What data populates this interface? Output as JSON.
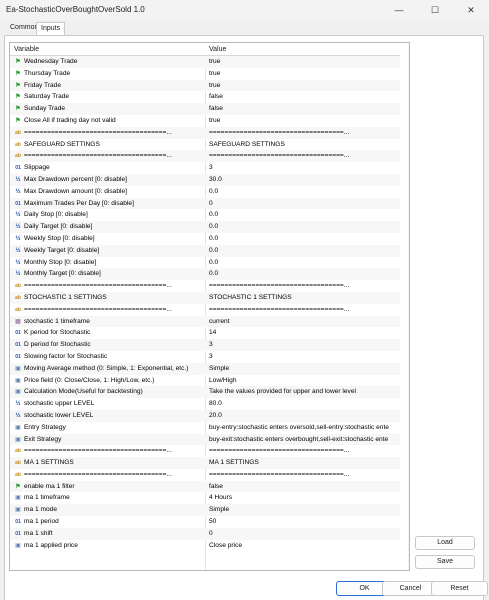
{
  "window": {
    "title": "Ea-StochasticOverBoughtOverSold 1.0",
    "minimize_glyph": "—",
    "maximize_glyph": "☐",
    "close_glyph": "✕"
  },
  "tabs": [
    {
      "label": "Common"
    },
    {
      "label": "Inputs"
    }
  ],
  "grid": {
    "headers": {
      "variable": "Variable",
      "value": "Value"
    },
    "rows": [
      {
        "type": "bool",
        "icon": "green-flag-icon",
        "label": "Wednesday Trade",
        "value": "true"
      },
      {
        "type": "bool",
        "icon": "green-flag-icon",
        "label": "Thursday Trade",
        "value": "true"
      },
      {
        "type": "bool",
        "icon": "green-flag-icon",
        "label": "Friday Trade",
        "value": "true"
      },
      {
        "type": "bool",
        "icon": "green-flag-icon",
        "label": "Saturday Trade",
        "value": "false"
      },
      {
        "type": "bool",
        "icon": "green-flag-icon",
        "label": "Sunday Trade",
        "value": "false"
      },
      {
        "type": "bool",
        "icon": "green-flag-icon",
        "label": "Close All if trading day not valid",
        "value": "true"
      },
      {
        "type": "ab",
        "icon": "string-icon",
        "label": "=====================================...",
        "value": "===================================..."
      },
      {
        "type": "ab",
        "icon": "string-icon",
        "label": "SAFEGUARD SETTINGS",
        "value": "SAFEGUARD SETTINGS"
      },
      {
        "type": "ab",
        "icon": "string-icon",
        "label": "=====================================...",
        "value": "===================================..."
      },
      {
        "type": "int",
        "icon": "integer-icon",
        "label": "Slippage",
        "value": "3"
      },
      {
        "type": "dbl",
        "icon": "double-icon",
        "label": "Max Drawdown percent [0: disable]",
        "value": "30.0"
      },
      {
        "type": "dbl",
        "icon": "double-icon",
        "label": "Max Drawdown amount [0: disable]",
        "value": "0.0"
      },
      {
        "type": "int",
        "icon": "integer-icon",
        "label": "Maximum Trades Per Day [0: disable]",
        "value": "0"
      },
      {
        "type": "dbl",
        "icon": "double-icon",
        "label": "Daily Stop [0: disable]",
        "value": "0.0"
      },
      {
        "type": "dbl",
        "icon": "double-icon",
        "label": "Daily Target [0: disable]",
        "value": "0.0"
      },
      {
        "type": "dbl",
        "icon": "double-icon",
        "label": "Weekly Stop [0: disable]",
        "value": "0.0"
      },
      {
        "type": "dbl",
        "icon": "double-icon",
        "label": "Weekly Target [0: disable]",
        "value": "0.0"
      },
      {
        "type": "dbl",
        "icon": "double-icon",
        "label": "Monthly Stop [0: disable]",
        "value": "0.0"
      },
      {
        "type": "dbl",
        "icon": "double-icon",
        "label": "Monthly Target [0: disable]",
        "value": "0.0"
      },
      {
        "type": "ab",
        "icon": "string-icon",
        "label": "=====================================...",
        "value": "===================================..."
      },
      {
        "type": "ab",
        "icon": "string-icon",
        "label": "STOCHASTIC 1 SETTINGS",
        "value": "STOCHASTIC 1 SETTINGS"
      },
      {
        "type": "ab",
        "icon": "string-icon",
        "label": "=====================================...",
        "value": "===================================..."
      },
      {
        "type": "list",
        "icon": "timeframe-icon",
        "label": "stochastic 1 timeframe",
        "value": "current"
      },
      {
        "type": "int",
        "icon": "integer-icon",
        "label": "K period for Stochastic",
        "value": "14"
      },
      {
        "type": "int",
        "icon": "integer-icon",
        "label": "D period for Stochastic",
        "value": "3"
      },
      {
        "type": "int",
        "icon": "integer-icon",
        "label": "Slowing factor for Stochastic",
        "value": "3"
      },
      {
        "type": "enum",
        "icon": "enum-icon",
        "label": "Moving Average method (0: Simple, 1: Exponential, etc.)",
        "value": "Simple"
      },
      {
        "type": "enum",
        "icon": "enum-icon",
        "label": "Price field (0: Close/Close, 1: High/Low, etc.)",
        "value": "Low/High"
      },
      {
        "type": "enum",
        "icon": "enum-icon",
        "label": "Calculation Mode(Useful for backtesting)",
        "value": "Take the values provided for upper and lower level"
      },
      {
        "type": "dbl",
        "icon": "double-icon",
        "label": "stochastic upper LEVEL",
        "value": "80.0"
      },
      {
        "type": "dbl",
        "icon": "double-icon",
        "label": "stochastic lower LEVEL",
        "value": "20.0"
      },
      {
        "type": "enum",
        "icon": "enum-icon",
        "label": "Entry Strategy",
        "value": "buy-entry:stochastic enters oversold,sell-entry:stochastic ente"
      },
      {
        "type": "enum",
        "icon": "enum-icon",
        "label": "Exit Strategy",
        "value": "buy-exit:stochastic enters overbought,sell-exit:stochastic ente"
      },
      {
        "type": "ab",
        "icon": "string-icon",
        "label": "=====================================...",
        "value": "===================================..."
      },
      {
        "type": "ab",
        "icon": "string-icon",
        "label": "MA 1 SETTINGS",
        "value": "MA 1 SETTINGS"
      },
      {
        "type": "ab",
        "icon": "string-icon",
        "label": "=====================================...",
        "value": "===================================..."
      },
      {
        "type": "bool",
        "icon": "green-flag-icon",
        "label": "enable ma 1 filter",
        "value": "false"
      },
      {
        "type": "enum",
        "icon": "enum-icon",
        "label": "ma 1 timeframe",
        "value": "4 Hours"
      },
      {
        "type": "enum",
        "icon": "enum-icon",
        "label": "ma 1 mode",
        "value": "Simple"
      },
      {
        "type": "int",
        "icon": "integer-icon",
        "label": "ma 1 period",
        "value": "50"
      },
      {
        "type": "int",
        "icon": "integer-icon",
        "label": "ma 1 shift",
        "value": "0"
      },
      {
        "type": "enum",
        "icon": "enum-icon",
        "label": "ma 1 applied price",
        "value": "Close price"
      }
    ]
  },
  "side_buttons": {
    "load": "Load",
    "save": "Save"
  },
  "bottom_buttons": {
    "ok": "OK",
    "cancel": "Cancel",
    "reset": "Reset"
  },
  "icon_glyphs": {
    "bool": "⚑",
    "ab": "ab",
    "int": "01",
    "dbl": "½",
    "enum": "▣",
    "list": "▦"
  },
  "colors": {
    "bool_icon": "#2a9a2a",
    "string_icon": "#c0891a",
    "number_icon": "#2050b0",
    "ok_border": "#2c6fd1"
  }
}
